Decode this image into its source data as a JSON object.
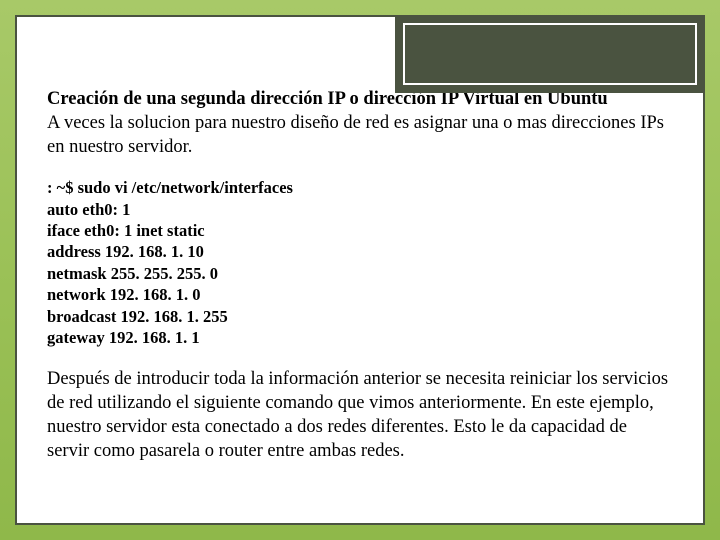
{
  "title": "Creación de una segunda dirección IP o dirección IP Virtual en Ubuntu",
  "intro": "A veces la solucion para nuestro diseño de red es asignar una o mas direcciones IPs en nuestro servidor.",
  "code": {
    "line1": ": ~$ sudo vi /etc/network/interfaces",
    "line2": "auto eth0: 1",
    "line3": "iface eth0: 1 inet static",
    "line4": "address 192. 168. 1. 10",
    "line5": "netmask 255. 255. 255. 0",
    "line6": "network 192. 168. 1. 0",
    "line7": "broadcast 192. 168. 1. 255",
    "line8": "gateway 192. 168. 1. 1"
  },
  "outro": "Después de introducir toda la información anterior se necesita reiniciar los servicios de red utilizando el siguiente comando que vimos anteriormente. En este ejemplo, nuestro servidor esta conectado a dos redes diferentes. Esto le da capacidad de servir como pasarela o router entre ambas redes."
}
